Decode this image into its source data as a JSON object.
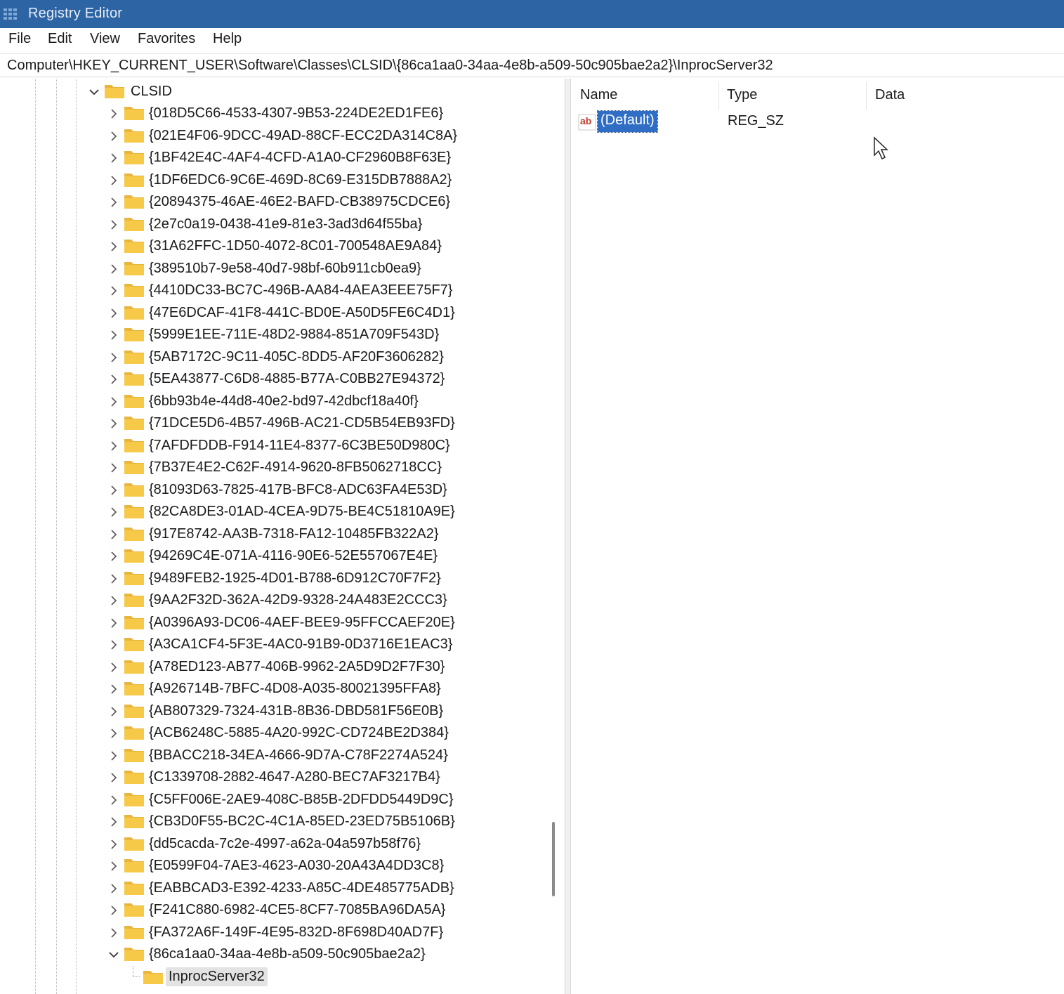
{
  "window": {
    "title": "Registry Editor",
    "app_icon": "regedit-icon"
  },
  "menu": {
    "items": [
      "File",
      "Edit",
      "View",
      "Favorites",
      "Help"
    ]
  },
  "address": {
    "path": "Computer\\HKEY_CURRENT_USER\\Software\\Classes\\CLSID\\{86ca1aa0-34aa-4e8b-a509-50c905bae2a2}\\InprocServer32"
  },
  "tree": {
    "parent_key": "CLSID",
    "keys": [
      "{018D5C66-4533-4307-9B53-224DE2ED1FE6}",
      "{021E4F06-9DCC-49AD-88CF-ECC2DA314C8A}",
      "{1BF42E4C-4AF4-4CFD-A1A0-CF2960B8F63E}",
      "{1DF6EDC6-9C6E-469D-8C69-E315DB7888A2}",
      "{20894375-46AE-46E2-BAFD-CB38975CDCE6}",
      "{2e7c0a19-0438-41e9-81e3-3ad3d64f55ba}",
      "{31A62FFC-1D50-4072-8C01-700548AE9A84}",
      "{389510b7-9e58-40d7-98bf-60b911cb0ea9}",
      "{4410DC33-BC7C-496B-AA84-4AEA3EEE75F7}",
      "{47E6DCAF-41F8-441C-BD0E-A50D5FE6C4D1}",
      "{5999E1EE-711E-48D2-9884-851A709F543D}",
      "{5AB7172C-9C11-405C-8DD5-AF20F3606282}",
      "{5EA43877-C6D8-4885-B77A-C0BB27E94372}",
      "{6bb93b4e-44d8-40e2-bd97-42dbcf18a40f}",
      "{71DCE5D6-4B57-496B-AC21-CD5B54EB93FD}",
      "{7AFDFDDB-F914-11E4-8377-6C3BE50D980C}",
      "{7B37E4E2-C62F-4914-9620-8FB5062718CC}",
      "{81093D63-7825-417B-BFC8-ADC63FA4E53D}",
      "{82CA8DE3-01AD-4CEA-9D75-BE4C51810A9E}",
      "{917E8742-AA3B-7318-FA12-10485FB322A2}",
      "{94269C4E-071A-4116-90E6-52E557067E4E}",
      "{9489FEB2-1925-4D01-B788-6D912C70F7F2}",
      "{9AA2F32D-362A-42D9-9328-24A483E2CCC3}",
      "{A0396A93-DC06-4AEF-BEE9-95FFCCAEF20E}",
      "{A3CA1CF4-5F3E-4AC0-91B9-0D3716E1EAC3}",
      "{A78ED123-AB77-406B-9962-2A5D9D2F7F30}",
      "{A926714B-7BFC-4D08-A035-80021395FFA8}",
      "{AB807329-7324-431B-8B36-DBD581F56E0B}",
      "{ACB6248C-5885-4A20-992C-CD724BE2D384}",
      "{BBACC218-34EA-4666-9D7A-C78F2274A524}",
      "{C1339708-2882-4647-A280-BEC7AF3217B4}",
      "{C5FF006E-2AE9-408C-B85B-2DFDD5449D9C}",
      "{CB3D0F55-BC2C-4C1A-85ED-23ED75B5106B}",
      "{dd5cacda-7c2e-4997-a62a-04a597b58f76}",
      "{E0599F04-7AE3-4623-A030-20A43A4DD3C8}",
      "{EABBCAD3-E392-4233-A85C-4DE485775ADB}",
      "{F241C880-6982-4CE5-8CF7-7085BA96DA5A}",
      "{FA372A6F-149F-4E95-832D-8F698D40AD7F}",
      "{86ca1aa0-34aa-4e8b-a509-50c905bae2a2}"
    ],
    "expanded_key_index": 38,
    "child_key": "InprocServer32"
  },
  "list": {
    "columns": [
      "Name",
      "Type",
      "Data"
    ],
    "rows": [
      {
        "name": "(Default)",
        "type": "REG_SZ",
        "data": "",
        "icon": "string-value-icon"
      }
    ]
  },
  "colors": {
    "titlebar": "#2d64a3",
    "selection": "#2f6ec4",
    "folder": "#f5c542"
  }
}
